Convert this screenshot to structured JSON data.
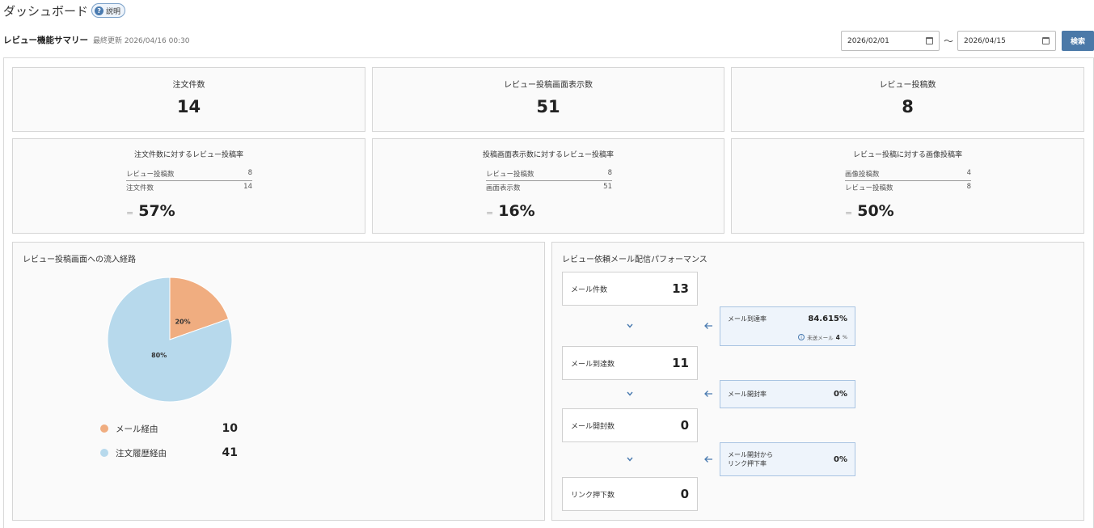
{
  "header": {
    "title": "ダッシュボード",
    "help_label": "説明"
  },
  "summary": {
    "title": "レビュー機能サマリー",
    "updated": "最終更新 2026/04/16 00:30"
  },
  "filter": {
    "start_date": "2026/02/01",
    "tilde": "〜",
    "end_date": "2026/04/15",
    "search_label": "検索"
  },
  "stats": [
    {
      "label": "注文件数",
      "value": "14"
    },
    {
      "label": "レビュー投稿画面表示数",
      "value": "51"
    },
    {
      "label": "レビュー投稿数",
      "value": "8"
    }
  ],
  "rates": [
    {
      "title": "注文件数に対するレビュー投稿率",
      "num_label": "レビュー投稿数",
      "num_value": "8",
      "den_label": "注文件数",
      "den_value": "14",
      "eq": "=",
      "result": "57%"
    },
    {
      "title": "投稿画面表示数に対するレビュー投稿率",
      "num_label": "レビュー投稿数",
      "num_value": "8",
      "den_label": "画面表示数",
      "den_value": "51",
      "eq": "=",
      "result": "16%"
    },
    {
      "title": "レビュー投稿に対する画像投稿率",
      "num_label": "画像投稿数",
      "num_value": "4",
      "den_label": "レビュー投稿数",
      "den_value": "8",
      "eq": "=",
      "result": "50%"
    }
  ],
  "traffic": {
    "title": "レビュー投稿画面への流入経路",
    "chart_data": {
      "type": "pie",
      "slices": [
        {
          "label": "メール経由",
          "value": 10,
          "percent_label": "20%",
          "color": "#f0ad80"
        },
        {
          "label": "注文履歴経由",
          "value": 41,
          "percent_label": "80%",
          "color": "#b7d9ec"
        }
      ]
    },
    "legend": [
      {
        "label": "メール経由",
        "value": "10"
      },
      {
        "label": "注文履歴経由",
        "value": "41"
      }
    ]
  },
  "mail": {
    "title": "レビュー依頼メール配信パフォーマンス",
    "counts": [
      {
        "label": "メール件数",
        "value": "13"
      },
      {
        "label": "メール到達数",
        "value": "11"
      },
      {
        "label": "メール開封数",
        "value": "0"
      },
      {
        "label": "リンク押下数",
        "value": "0"
      }
    ],
    "rates": [
      {
        "label": "メール到達率",
        "value": "84.615%",
        "unsent_label": "未送メール",
        "unsent_value": "4",
        "unsent_unit": "%"
      },
      {
        "label": "メール開封率",
        "value": "0%"
      },
      {
        "label_line1": "メール開封から",
        "label_line2": "リンク押下率",
        "value": "0%"
      }
    ]
  },
  "colors": {
    "accent": "#4b79a8",
    "rate_box_bg": "#eef4fb",
    "pie_mail": "#f0ad80",
    "pie_history": "#b7d9ec"
  }
}
